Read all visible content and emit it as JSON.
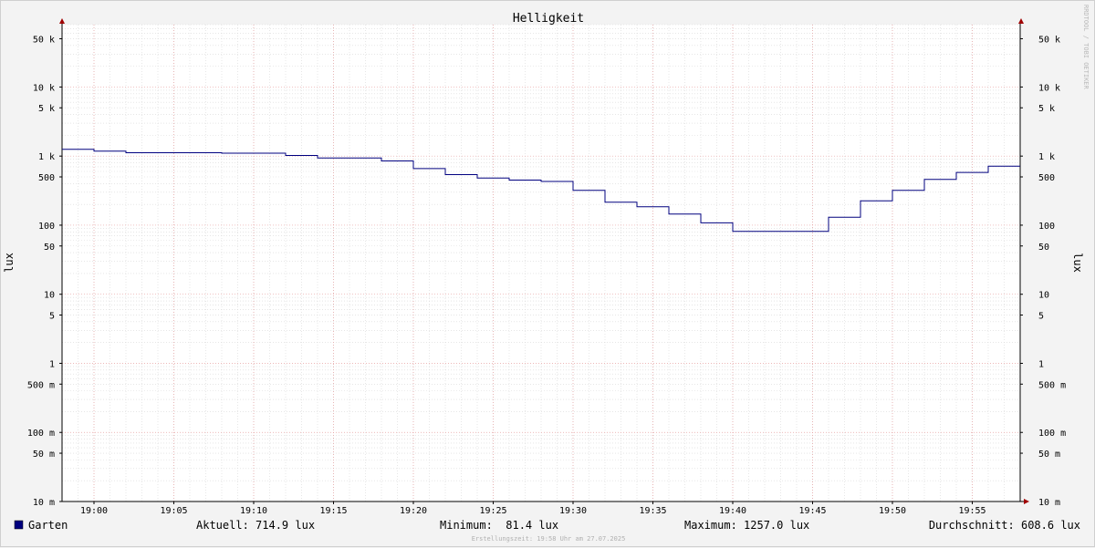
{
  "chart_data": {
    "type": "line",
    "title": "Helligkeit",
    "ylabel": "lux",
    "yscale": "log",
    "ylim": [
      0.01,
      80000
    ],
    "y_ticks": [
      {
        "value": 50000,
        "label": "50 k"
      },
      {
        "value": 10000,
        "label": "10 k"
      },
      {
        "value": 5000,
        "label": "5 k"
      },
      {
        "value": 1000,
        "label": "1 k"
      },
      {
        "value": 500,
        "label": "500"
      },
      {
        "value": 100,
        "label": "100"
      },
      {
        "value": 50,
        "label": "50"
      },
      {
        "value": 10,
        "label": "10"
      },
      {
        "value": 5,
        "label": "5"
      },
      {
        "value": 1,
        "label": "1"
      },
      {
        "value": 0.5,
        "label": "500 m"
      },
      {
        "value": 0.1,
        "label": "100 m"
      },
      {
        "value": 0.05,
        "label": "50 m"
      },
      {
        "value": 0.01,
        "label": "10 m"
      }
    ],
    "xlim": [
      "18:58",
      "19:58"
    ],
    "x_ticks": [
      "19:00",
      "19:05",
      "19:10",
      "19:15",
      "19:20",
      "19:25",
      "19:30",
      "19:35",
      "19:40",
      "19:45",
      "19:50",
      "19:55"
    ],
    "series": [
      {
        "name": "Garten",
        "color": "#00007f",
        "step": true,
        "x": [
          "18:58",
          "19:00",
          "19:02",
          "19:04",
          "19:06",
          "19:08",
          "19:10",
          "19:12",
          "19:14",
          "19:16",
          "19:18",
          "19:20",
          "19:22",
          "19:24",
          "19:26",
          "19:28",
          "19:30",
          "19:32",
          "19:34",
          "19:36",
          "19:38",
          "19:40",
          "19:42",
          "19:44",
          "19:46",
          "19:48",
          "19:50",
          "19:52",
          "19:54",
          "19:56"
        ],
        "y": [
          1257,
          1180,
          1120,
          1120,
          1120,
          1100,
          1100,
          1020,
          940,
          940,
          850,
          660,
          540,
          480,
          450,
          430,
          320,
          215,
          185,
          145,
          108,
          81.4,
          81.4,
          81.4,
          130,
          225,
          320,
          460,
          580,
          714.9
        ]
      }
    ]
  },
  "legend": {
    "series_name": "Garten",
    "swatch_color": "#00007f",
    "current": "Aktuell: 714.9 lux",
    "minimum": "Minimum:  81.4 lux",
    "maximum": "Maximum: 1257.0 lux",
    "average": "Durchschnitt: 608.6 lux"
  },
  "watermark": "RRDTOOL / TOBI OETIKER",
  "footer": "Erstellungszeit: 19:58 Uhr am 27.07.2025"
}
